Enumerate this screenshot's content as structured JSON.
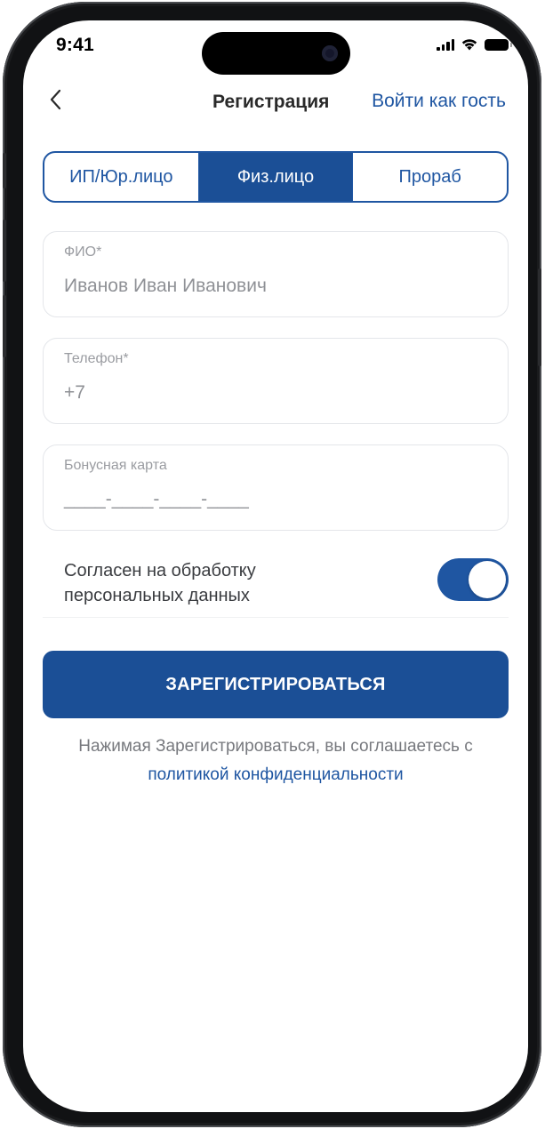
{
  "status_bar": {
    "time": "9:41",
    "icons": [
      "signal-icon",
      "wifi-icon",
      "battery-icon"
    ]
  },
  "header": {
    "back_icon": "chevron-left-icon",
    "title": "Регистрация",
    "guest_link": "Войти как гость"
  },
  "segments": [
    {
      "label": "ИП/Юр.лицо",
      "active": false
    },
    {
      "label": "Физ.лицо",
      "active": true
    },
    {
      "label": "Прораб",
      "active": false
    }
  ],
  "form": {
    "fio": {
      "label": "ФИО*",
      "placeholder": "Иванов Иван Иванович"
    },
    "phone": {
      "label": "Телефон*",
      "placeholder": "+7"
    },
    "bonus_card": {
      "label": "Бонусная карта",
      "placeholder": "____-____-____-____"
    }
  },
  "consent": {
    "text": "Согласен на обработку персональных данных",
    "enabled": true
  },
  "submit_label": "ЗАРЕГИСТРИРОВАТЬСЯ",
  "disclaimer": {
    "text": "Нажимая Зарегистрироваться, вы соглашаетесь с",
    "link": "политикой конфиденциальности"
  },
  "colors": {
    "accent": "#1f56a2",
    "accent_dark": "#1b4f96",
    "field_border": "#e4e6ea",
    "muted_text": "#9a9ca1"
  }
}
